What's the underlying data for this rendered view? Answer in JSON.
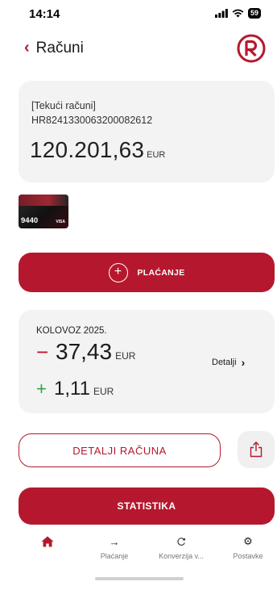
{
  "status_bar": {
    "time": "14:14",
    "battery": "59"
  },
  "header": {
    "title": "Računi",
    "back_icon": "chevron-left-icon",
    "logo_icon": "bank-logo-icon"
  },
  "account": {
    "type": "[Tekući računi]",
    "iban": "HR8241330063200082612",
    "balance": "120.201,63",
    "currency": "EUR"
  },
  "card": {
    "last_digits": "9440",
    "brand": "VISA"
  },
  "pay_button": {
    "label": "PLAĆANJE",
    "icon": "plus-circle-icon"
  },
  "summary": {
    "month": "KOLOVOZ 2025.",
    "outgoing_sign": "−",
    "outgoing_amount": "37,43",
    "outgoing_currency": "EUR",
    "incoming_sign": "+",
    "incoming_amount": "1,11",
    "incoming_currency": "EUR",
    "details_label": "Detalji"
  },
  "account_details_button": {
    "label": "DETALJI RAČUNA"
  },
  "share_button": {
    "icon": "share-icon"
  },
  "statistics_button": {
    "label": "STATISTIKA"
  },
  "nav": {
    "items": [
      {
        "label": "",
        "icon": "home-icon",
        "active": true
      },
      {
        "label": "Plaćanje",
        "icon": "arrow-right-icon"
      },
      {
        "label": "Konverzija v...",
        "icon": "refresh-icon"
      },
      {
        "label": "Postavke",
        "icon": "gear-icon"
      }
    ]
  },
  "colors": {
    "brand": "#b5182e",
    "minus": "#c2182e",
    "plus": "#2aa84a",
    "card_bg": "#f3f3f3"
  }
}
